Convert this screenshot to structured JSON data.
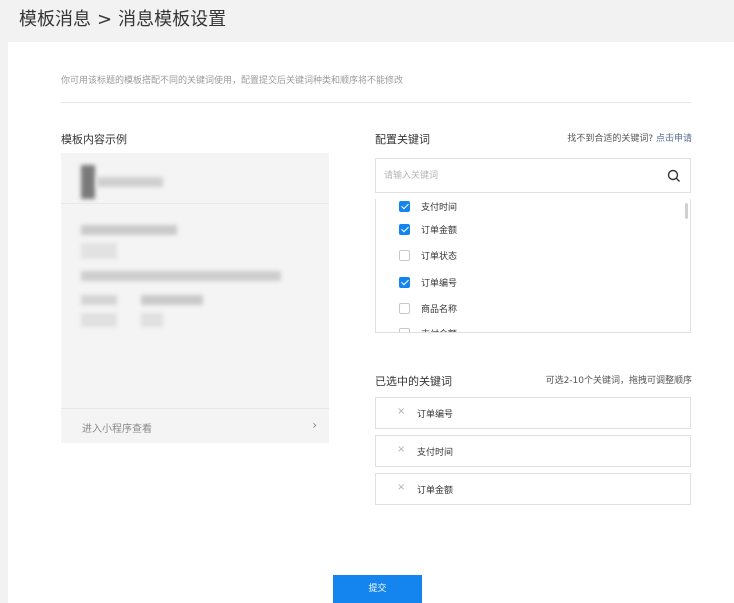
{
  "header": {
    "breadcrumb_parent": "模板消息",
    "separator": ">",
    "title": "消息模板设置"
  },
  "description": "你可用该标题的模板搭配不同的关键词使用，配置提交后关键词种类和顺序将不能修改",
  "preview": {
    "title": "模板内容示例",
    "footer_label": "进入小程序查看",
    "footer_arrow": "›"
  },
  "keywords": {
    "title": "配置关键词",
    "help_text": "找不到合适的关键词?",
    "help_link": "点击申请",
    "search_placeholder": "请输入关键词",
    "items": [
      {
        "label": "支付时间",
        "checked": true
      },
      {
        "label": "订单金额",
        "checked": true
      },
      {
        "label": "订单状态",
        "checked": false
      },
      {
        "label": "订单编号",
        "checked": true
      },
      {
        "label": "商品名称",
        "checked": false
      },
      {
        "label": "支付金额",
        "checked": false
      }
    ]
  },
  "selected": {
    "title": "已选中的关键词",
    "hint": "可选2-10个关键词，拖拽可调整顺序",
    "remove_symbol": "×",
    "items": [
      "订单编号",
      "支付时间",
      "订单金额"
    ]
  },
  "submit_label": "提交",
  "colors": {
    "accent": "#1485ee",
    "link": "#576b95"
  }
}
